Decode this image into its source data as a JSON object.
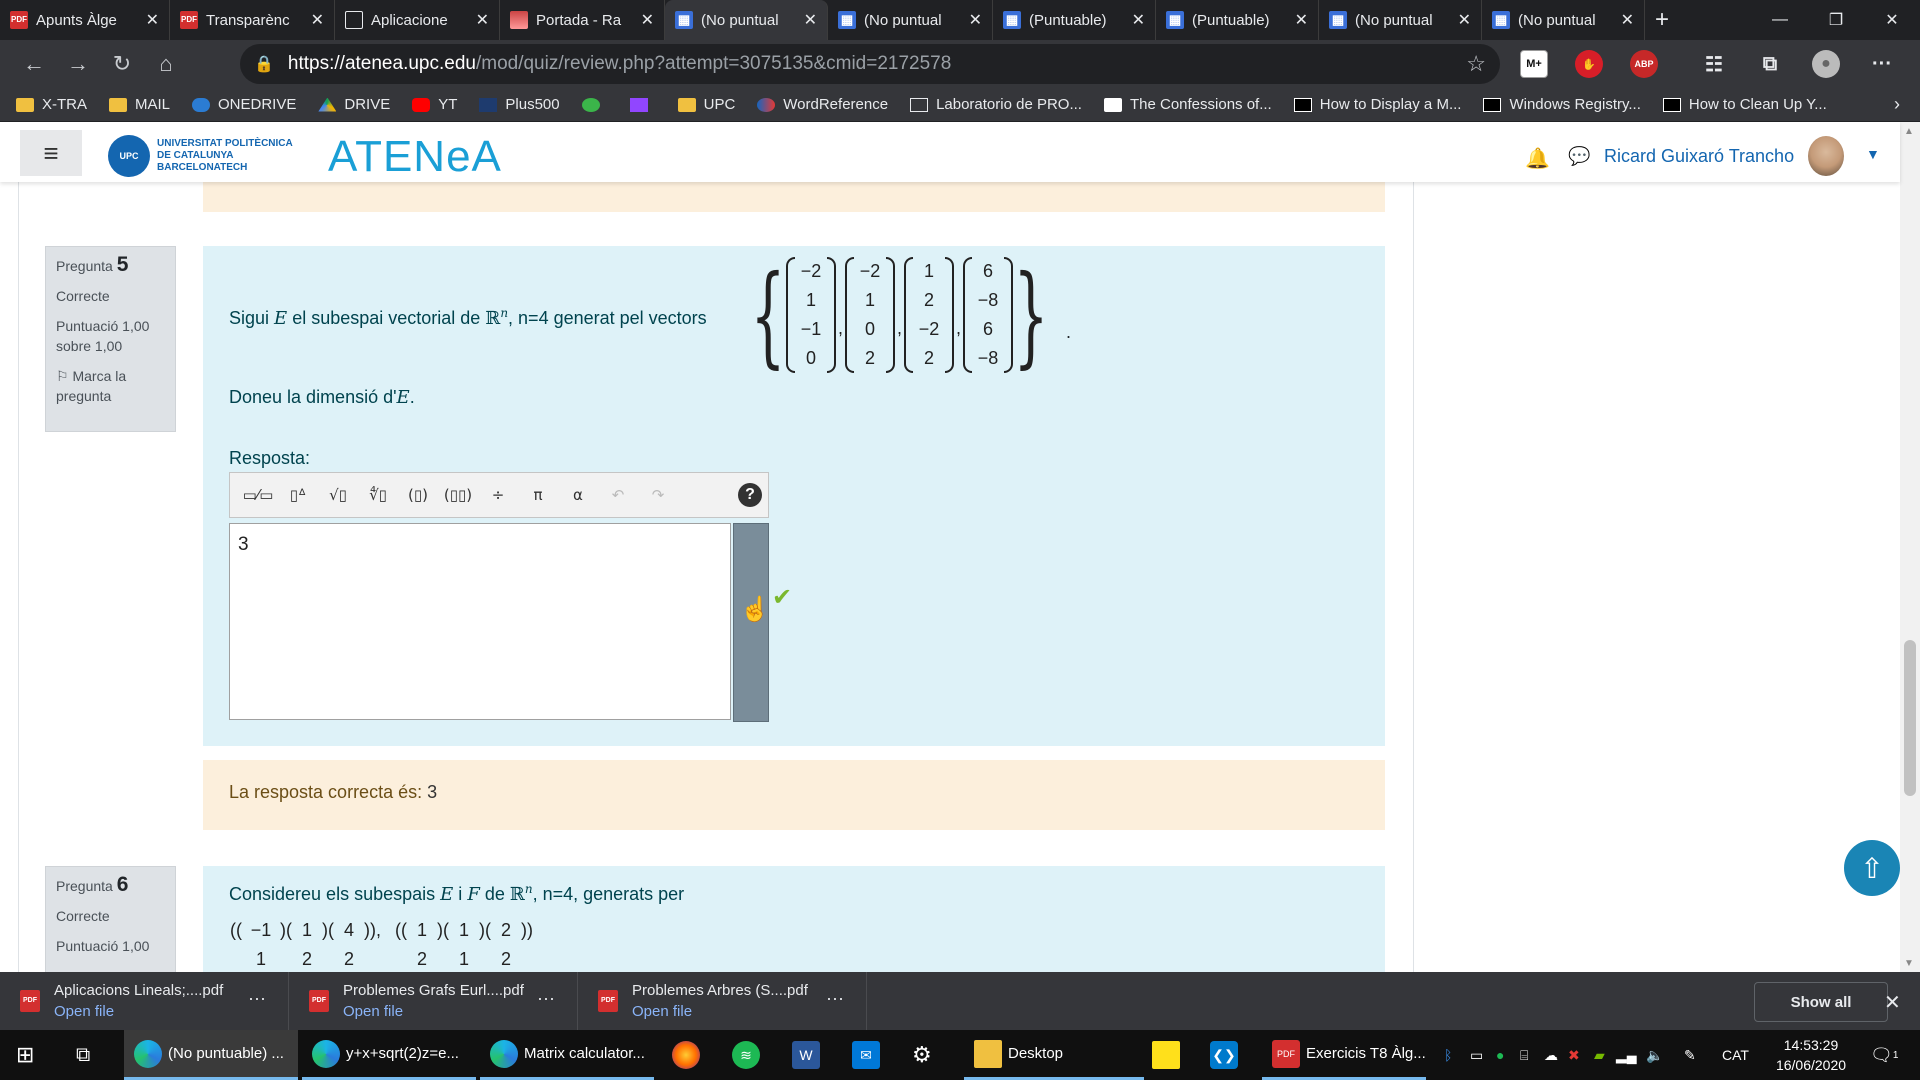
{
  "browser": {
    "tabs": [
      {
        "title": "Apunts Àlge",
        "favicon": "pdf-icon"
      },
      {
        "title": "Transparènc",
        "favicon": "pdf-icon"
      },
      {
        "title": "Aplicacione",
        "favicon": "page-icon"
      },
      {
        "title": "Portada - Ra",
        "favicon": "rp-icon"
      },
      {
        "title": "(No puntual",
        "favicon": "moodle-icon",
        "active": true
      },
      {
        "title": "(No puntual",
        "favicon": "moodle-icon"
      },
      {
        "title": "(Puntuable)",
        "favicon": "moodle-icon"
      },
      {
        "title": "(Puntuable)",
        "favicon": "moodle-icon"
      },
      {
        "title": "(No puntual",
        "favicon": "moodle-icon"
      },
      {
        "title": "(No puntual",
        "favicon": "moodle-icon"
      }
    ],
    "url_host": "https://atenea.upc.edu",
    "url_path": "/mod/quiz/review.php?attempt=3075135&cmid=2172578",
    "extensions": [
      "M+",
      "ABP"
    ],
    "bookmarks": [
      "X-TRA",
      "MAIL",
      "ONEDRIVE",
      "DRIVE",
      "YT",
      "Plus500",
      "",
      "",
      "UPC",
      "WordReference",
      "Laboratorio de PRO...",
      "The Confessions of...",
      "How to Display a M...",
      "Windows Registry...",
      "How to Clean Up Y..."
    ]
  },
  "site": {
    "university_lines": [
      "UNIVERSITAT POLITÈCNICA",
      "DE CATALUNYA",
      "BARCELONATECH"
    ],
    "logo_text": "ATENeA",
    "user_name": "Ricard Guixaró Trancho"
  },
  "question5": {
    "label": "Pregunta",
    "number": "5",
    "state": "Correcte",
    "grade": "Puntuació 1,00 sobre 1,00",
    "flag": "Marca la pregunta",
    "text_before": "Sigui",
    "var_E": "E",
    "text_mid": "el subespai vectorial de",
    "space": "ℝ",
    "sup_n": "n",
    "text_after": ", n=4  generat pel vectors",
    "vectors": [
      [
        "−2",
        "1",
        "−1",
        "0"
      ],
      [
        "−2",
        "1",
        "0",
        "2"
      ],
      [
        "1",
        "2",
        "−2",
        "2"
      ],
      [
        "6",
        "−8",
        "6",
        "−8"
      ]
    ],
    "prompt": "Doneu la dimensió  d'",
    "prompt_var": "E",
    "answer_label": "Resposta:",
    "answer_value": "3",
    "correct_label": "La resposta correcta és:",
    "correct_value": "3"
  },
  "question6": {
    "label": "Pregunta",
    "number": "6",
    "state": "Correcte",
    "grade": "Puntuació 1,00",
    "text": "Considereu els subespais",
    "var_E": "E",
    "and": "i",
    "var_F": "F",
    "de": "de",
    "space": "ℝ",
    "sup_n": "n",
    "n_eq": ", n=4, generats per",
    "vectors_row1": [
      "−1",
      "1",
      "4",
      "1",
      "1",
      "2"
    ],
    "vectors_row2": [
      "1",
      "2",
      "2",
      "2",
      "1",
      "2"
    ]
  },
  "downloads": [
    {
      "name": "Aplicacions Lineals;....pdf",
      "action": "Open file"
    },
    {
      "name": "Problemes Grafs Eurl....pdf",
      "action": "Open file"
    },
    {
      "name": "Problemes Arbres (S....pdf",
      "action": "Open file"
    }
  ],
  "show_all": "Show all",
  "taskbar": {
    "apps": [
      "(No puntuable) ...",
      "y+x+sqrt(2)z=e...",
      "Matrix calculator...",
      "Desktop",
      "Exercicis T8 Àlg..."
    ],
    "lang": "CAT",
    "time": "14:53:29",
    "date": "16/06/2020",
    "notif_count": "1"
  }
}
